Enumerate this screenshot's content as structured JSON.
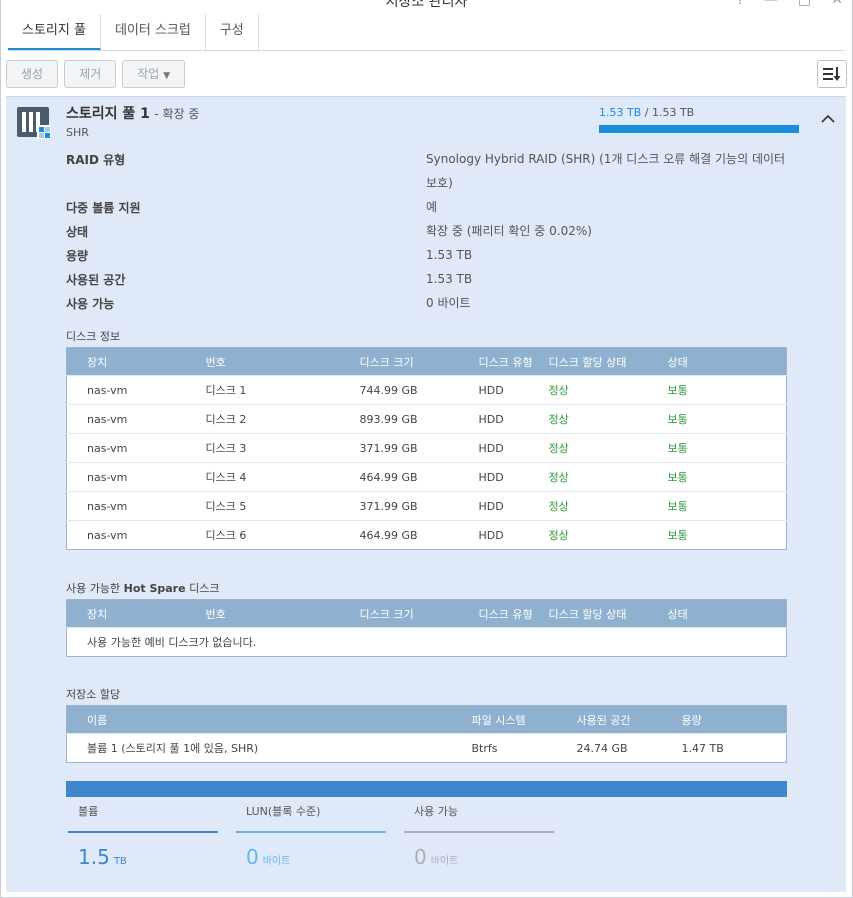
{
  "window": {
    "title": "저장소 관리자",
    "controls": [
      "?",
      "—",
      "□",
      "✕"
    ]
  },
  "tabs": [
    {
      "label": "스토리지 풀"
    },
    {
      "label": "데이터 스크럽"
    },
    {
      "label": "구성"
    }
  ],
  "toolbar": {
    "create": "생성",
    "remove": "제거",
    "action": "작업"
  },
  "pool": {
    "name": "스토리지 풀 1",
    "status_suffix": "- 확장 중",
    "type": "SHR",
    "used": "1.53 TB",
    "total": "1.53 TB",
    "used_fraction": 1.0,
    "bar_color": "#1a8ddc"
  },
  "details": [
    {
      "key": "RAID 유형",
      "value": "Synology Hybrid RAID (SHR) (1개 디스크 오류 해결 기능의 데이터 보호)"
    },
    {
      "key": "다중 볼륨 지원",
      "value": "예"
    },
    {
      "key": "상태",
      "value": "확장 중 (패리티 확인 중 0.02%)"
    },
    {
      "key": "용량",
      "value": "1.53 TB"
    },
    {
      "key": "사용된 공간",
      "value": "1.53 TB"
    },
    {
      "key": "사용 가능",
      "value": "0 바이트"
    }
  ],
  "disk_info": {
    "title": "디스크 정보",
    "headers": [
      "장치",
      "번호",
      "디스크 크기",
      "디스크 유형",
      "디스크 할당 상태",
      "상태"
    ],
    "rows": [
      [
        "nas-vm",
        "디스크 1",
        "744.99 GB",
        "HDD",
        "정상",
        "보통"
      ],
      [
        "nas-vm",
        "디스크 2",
        "893.99 GB",
        "HDD",
        "정상",
        "보통"
      ],
      [
        "nas-vm",
        "디스크 3",
        "371.99 GB",
        "HDD",
        "정상",
        "보통"
      ],
      [
        "nas-vm",
        "디스크 4",
        "464.99 GB",
        "HDD",
        "정상",
        "보통"
      ],
      [
        "nas-vm",
        "디스크 5",
        "371.99 GB",
        "HDD",
        "정상",
        "보통"
      ],
      [
        "nas-vm",
        "디스크 6",
        "464.99 GB",
        "HDD",
        "정상",
        "보통"
      ]
    ]
  },
  "hot_spare": {
    "title_prefix": "사용 가능한",
    "title_bold": "Hot Spare",
    "title_suffix": "디스크",
    "headers": [
      "장치",
      "번호",
      "디스크 크기",
      "디스크 유형",
      "디스크 할당 상태",
      "상태"
    ],
    "empty": "사용 가능한 예비 디스크가 없습니다."
  },
  "allocation": {
    "title": "저장소 할당",
    "headers": [
      "이름",
      "파일 시스템",
      "사용된 공간",
      "용량"
    ],
    "rows": [
      [
        "볼륨 1 (스토리지 풀 1에 있음, SHR)",
        "Btrfs",
        "24.74 GB",
        "1.47 TB"
      ]
    ]
  },
  "legend": [
    {
      "label": "볼륨",
      "value": "1.5",
      "unit": "TB",
      "color": "#3e87cf"
    },
    {
      "label": "LUN(블록 수준)",
      "value": "0",
      "unit": "바이트",
      "color": "#62b7ec"
    },
    {
      "label": "사용 가능",
      "value": "0",
      "unit": "바이트",
      "color": "#a9b0b8"
    }
  ]
}
